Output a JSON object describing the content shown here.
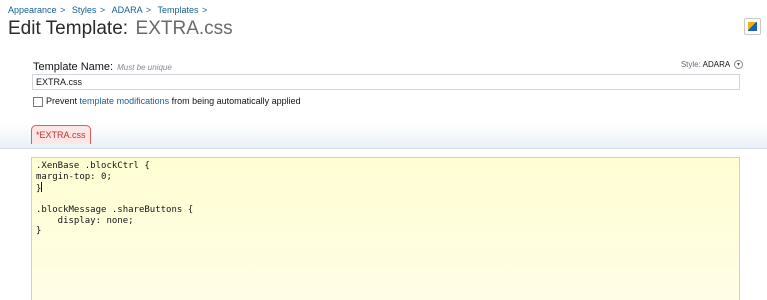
{
  "breadcrumb": [
    {
      "label": "Appearance",
      "sep": ">"
    },
    {
      "label": "Styles",
      "sep": ">"
    },
    {
      "label": "ADARA",
      "sep": ">"
    },
    {
      "label": "Templates",
      "sep": ">"
    }
  ],
  "header": {
    "title_label": "Edit Template:",
    "title_file": "EXTRA.css"
  },
  "form": {
    "template_name_label": "Template Name:",
    "template_name_hint": "Must be unique",
    "template_name_value": "EXTRA.css",
    "style_label": "Style:",
    "style_value": "ADARA",
    "prevent_before": "Prevent",
    "prevent_link": "template modifications",
    "prevent_after": "from being automatically applied",
    "prevent_checked": false
  },
  "tabs": [
    {
      "label": "*EXTRA.css",
      "active": true
    }
  ],
  "editor": {
    "lines": [
      ".XenBase .blockCtrl {",
      "margin-top: 0;",
      "}",
      "",
      ".blockMessage .shareButtons {",
      "    display: none;",
      "}"
    ],
    "caret_line": 2
  },
  "icons": {
    "corner": "style-properties-icon",
    "style_dropdown": "chevron-down-icon"
  },
  "colors": {
    "link": "#176093",
    "tab_border": "#e25b5b",
    "tab_text": "#c42f2f",
    "editor_bg": "#fffed2"
  }
}
